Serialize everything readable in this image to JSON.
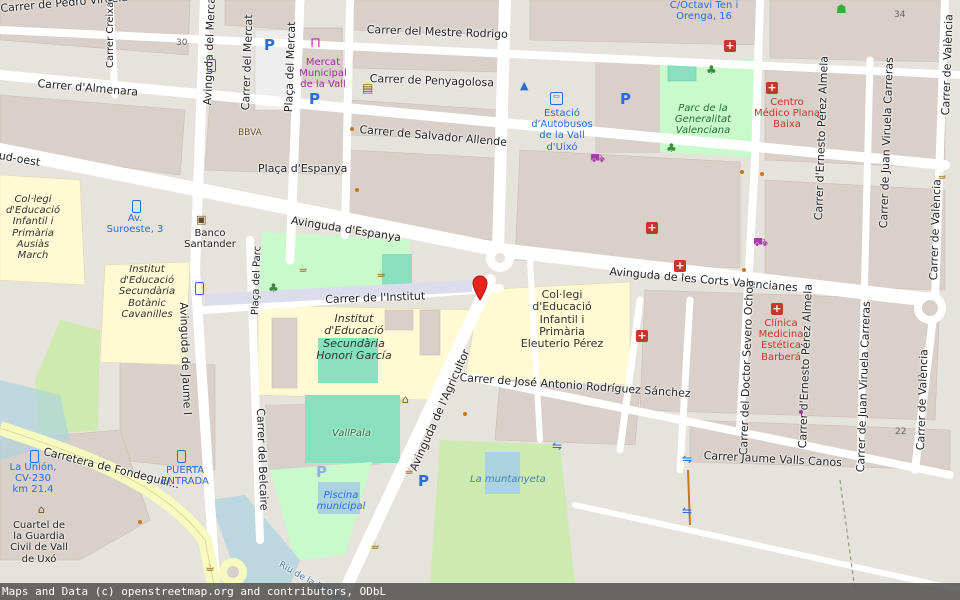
{
  "map": {
    "streets": {
      "pedro_viruela": "Carrer de Pedro Viruela",
      "creixach": "Carrer Creixach",
      "almenara": "Carrer d'Almenara",
      "av_mercat": "Avinguda del Mercat",
      "carrer_mercat": "Carrer del Mercat",
      "placa_mercat": "Plaça del Mercat",
      "mestre_rodrigo": "Carrer del Mestre Rodrigo",
      "penyagolosa": "Carrer de Penyagolosa",
      "salvador_allende": "Carrer de Salvador Allende",
      "placa_espanya": "Plaça d'Espanya",
      "ud_oest": "ud-oest",
      "av_espanya": "Avinguda d'Espanya",
      "corts_valencianes": "Avinguda de les Corts Valencianes",
      "placa_parc": "Plaça del Parc",
      "institut": "Carrer de l'Institut",
      "av_jaume": "Avinguda de Jaume I",
      "belcaire": "Carrer del Belcaire",
      "agricultor": "Avinguda de l'Agricultor",
      "jose_antonio": "Carrer de José Antonio Rodríguez Sánchez",
      "severo_ochoa": "Carrer del Doctor Severo Ochoa",
      "ernesto_1": "Carrer d'Ernesto Pérez Almela",
      "ernesto_2": "Carrer d'Ernesto Pérez Almela",
      "ernesto_3": "Carrer d'Ernesto Pérez Almela",
      "juan_viruela_1": "Carrer de Juan Viruela Carreras",
      "juan_viruela_2": "Carrer de Juan Viruela Carreras",
      "valencia_1": "Carrer de València",
      "valencia_2": "Carrer de València",
      "valencia_3": "Carrer de València",
      "valencia_4": "Carrer de València",
      "jaume_valls": "Carrer Jaume Valls Canos",
      "fondeguill": "Carretera de Fondeguill...",
      "riu": "Riu de la Belcaire"
    },
    "pois": {
      "mercat": "Mercat Municipal de la Vall",
      "estacio": "Estació d'Autobusos de la Vall d'Uixó",
      "parc": "Parc de la Generalitat Valenciana",
      "centro_medico": "Centro Médico Plana Baixa",
      "clinica": "Clínica Medicina Estética Barberá",
      "ceip_ausias": "Col·legi d'Educació Infantil i Primària Ausiàs March",
      "ies_cavanilles": "Institut d'Educació Secundària Botànic Cavanilles",
      "ies_garcia": "Institut d'Educació Secundària Honori García",
      "ceip_eleuterio": "Col·legi d'Educació Infantil i Primària Eleuterio Pérez",
      "bbva": "BBVA",
      "banco_santander": "Banco Santander",
      "av_suroeste": "Av. Suroeste, 3",
      "octavi": "C/Octavi Ten i Orenga, 16",
      "vallpala": "VallPala",
      "piscina": "Piscina municipal",
      "puerta": "PUERTA ENTRADA",
      "la_union": "La Unión, CV-230 km 21.4",
      "cuartel": "Cuartel de la Guardia Civil de Vall de Uxó",
      "muntanyeta": "La muntanyeta"
    },
    "house_numbers": {
      "n30": "30",
      "n34": "34",
      "n22": "22"
    },
    "icons": {
      "hospital": "hospital-icon",
      "parking": "parking-icon",
      "bus": "bus-stop-icon",
      "market": "market-icon",
      "shop": "shop-icon",
      "tree": "tree-icon",
      "cafe": "cafe-icon",
      "books": "books-icon",
      "bank": "bank-icon",
      "marker": "location-marker-icon"
    },
    "colors": {
      "background": "#f2efe9",
      "building": "#d9d0c9",
      "road": "#ffffff",
      "park": "#c8facc",
      "school": "#fffad4",
      "pitch": "#88e0be",
      "water": "#aad3df",
      "grass": "#cdebb0",
      "marker": "#e8241e"
    }
  },
  "attribution": "Maps and Data (c) openstreetmap.org and contributors, ODbL"
}
